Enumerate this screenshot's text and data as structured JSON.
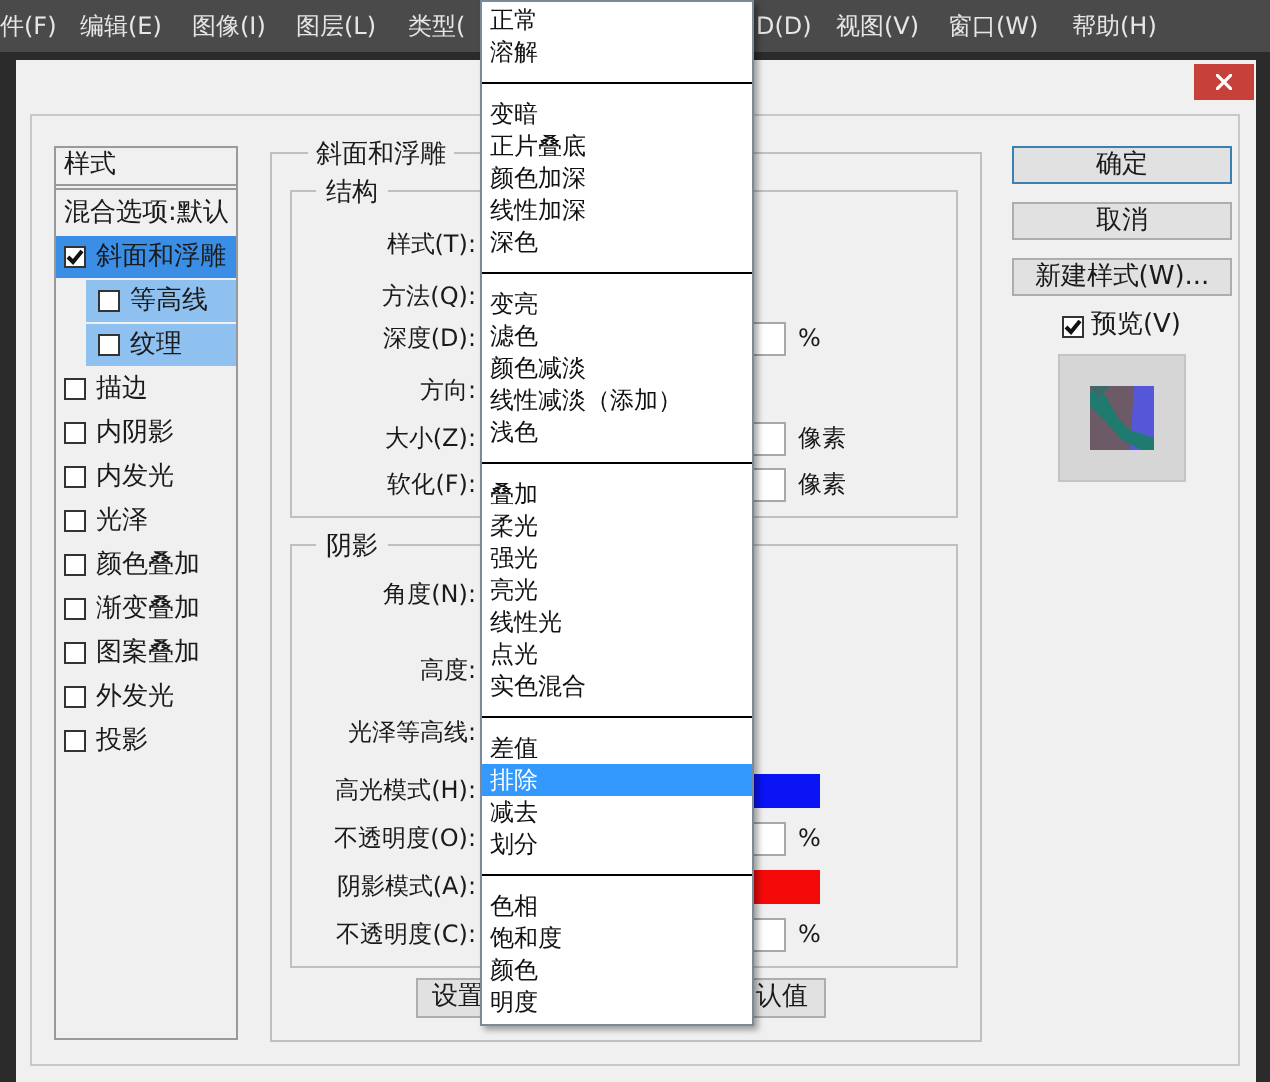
{
  "menu_bar": [
    {
      "label": "件(F)"
    },
    {
      "label": "编辑(E)"
    },
    {
      "label": "图像(I)"
    },
    {
      "label": "图层(L)"
    },
    {
      "label": "类型("
    },
    {
      "label": "D(D)"
    },
    {
      "label": "视图(V)"
    },
    {
      "label": "窗口(W)"
    },
    {
      "label": "帮助(H)"
    }
  ],
  "dialog": {
    "styles_panel": {
      "header": "样式",
      "blend_options": "混合选项:默认",
      "items": [
        {
          "label": "斜面和浮雕",
          "checked": true,
          "selected": true,
          "children": [
            {
              "label": "等高线",
              "checked": false,
              "selected": false
            },
            {
              "label": "纹理",
              "checked": false,
              "selected": false
            }
          ]
        },
        {
          "label": "描边",
          "checked": false,
          "selected": false
        },
        {
          "label": "内阴影",
          "checked": false,
          "selected": false
        },
        {
          "label": "内发光",
          "checked": false,
          "selected": false
        },
        {
          "label": "光泽",
          "checked": false,
          "selected": false
        },
        {
          "label": "颜色叠加",
          "checked": false,
          "selected": false
        },
        {
          "label": "渐变叠加",
          "checked": false,
          "selected": false
        },
        {
          "label": "图案叠加",
          "checked": false,
          "selected": false
        },
        {
          "label": "外发光",
          "checked": false,
          "selected": false
        },
        {
          "label": "投影",
          "checked": false,
          "selected": false
        }
      ]
    },
    "bevel_emboss": {
      "title": "斜面和浮雕",
      "structure": {
        "title": "结构",
        "rows": [
          {
            "label": "样式(T):",
            "kind": "plain"
          },
          {
            "label": "方法(Q):",
            "kind": "plain"
          },
          {
            "label": "深度(D):",
            "kind": "input",
            "unit": "%"
          },
          {
            "label": "方向:",
            "kind": "plain"
          },
          {
            "label": "大小(Z):",
            "kind": "input",
            "unit": "像素"
          },
          {
            "label": "软化(F):",
            "kind": "input",
            "unit": "像素"
          }
        ]
      },
      "shading": {
        "title": "阴影",
        "rows": [
          {
            "label": "角度(N):",
            "kind": "plain"
          },
          {
            "label": "高度:",
            "kind": "plain"
          },
          {
            "label": "光泽等高线:",
            "kind": "plain"
          },
          {
            "label": "高光模式(H):",
            "kind": "swatch",
            "color": "#0a14f5"
          },
          {
            "label": "不透明度(O):",
            "kind": "input",
            "unit": "%"
          },
          {
            "label": "阴影模式(A):",
            "kind": "swatch",
            "color": "#f50a0a"
          },
          {
            "label": "不透明度(C):",
            "kind": "input",
            "unit": "%"
          }
        ]
      },
      "buttons": [
        {
          "label": "设置"
        },
        {
          "label": "认值"
        }
      ]
    },
    "buttons": [
      {
        "label": "确定",
        "default": true
      },
      {
        "label": "取消",
        "default": false
      },
      {
        "label": "新建样式(W)...",
        "default": false
      }
    ],
    "preview": {
      "label": "预览(V)",
      "checked": true
    }
  },
  "blend_mode_menu": {
    "groups": [
      {
        "items": [
          {
            "label": "正常",
            "selected": false
          },
          {
            "label": "溶解",
            "selected": false
          }
        ]
      },
      {
        "items": [
          {
            "label": "变暗",
            "selected": false
          },
          {
            "label": "正片叠底",
            "selected": false
          },
          {
            "label": "颜色加深",
            "selected": false
          },
          {
            "label": "线性加深",
            "selected": false
          },
          {
            "label": "深色",
            "selected": false
          }
        ]
      },
      {
        "items": [
          {
            "label": "变亮",
            "selected": false
          },
          {
            "label": "滤色",
            "selected": false
          },
          {
            "label": "颜色减淡",
            "selected": false
          },
          {
            "label": "线性减淡（添加）",
            "selected": false
          },
          {
            "label": "浅色",
            "selected": false
          }
        ]
      },
      {
        "items": [
          {
            "label": "叠加",
            "selected": false
          },
          {
            "label": "柔光",
            "selected": false
          },
          {
            "label": "强光",
            "selected": false
          },
          {
            "label": "亮光",
            "selected": false
          },
          {
            "label": "线性光",
            "selected": false
          },
          {
            "label": "点光",
            "selected": false
          },
          {
            "label": "实色混合",
            "selected": false
          }
        ]
      },
      {
        "items": [
          {
            "label": "差值",
            "selected": false
          },
          {
            "label": "排除",
            "selected": true
          },
          {
            "label": "减去",
            "selected": false
          },
          {
            "label": "划分",
            "selected": false
          }
        ]
      },
      {
        "items": [
          {
            "label": "色相",
            "selected": false
          },
          {
            "label": "饱和度",
            "selected": false
          },
          {
            "label": "颜色",
            "selected": false
          },
          {
            "label": "明度",
            "selected": false
          }
        ]
      }
    ]
  }
}
